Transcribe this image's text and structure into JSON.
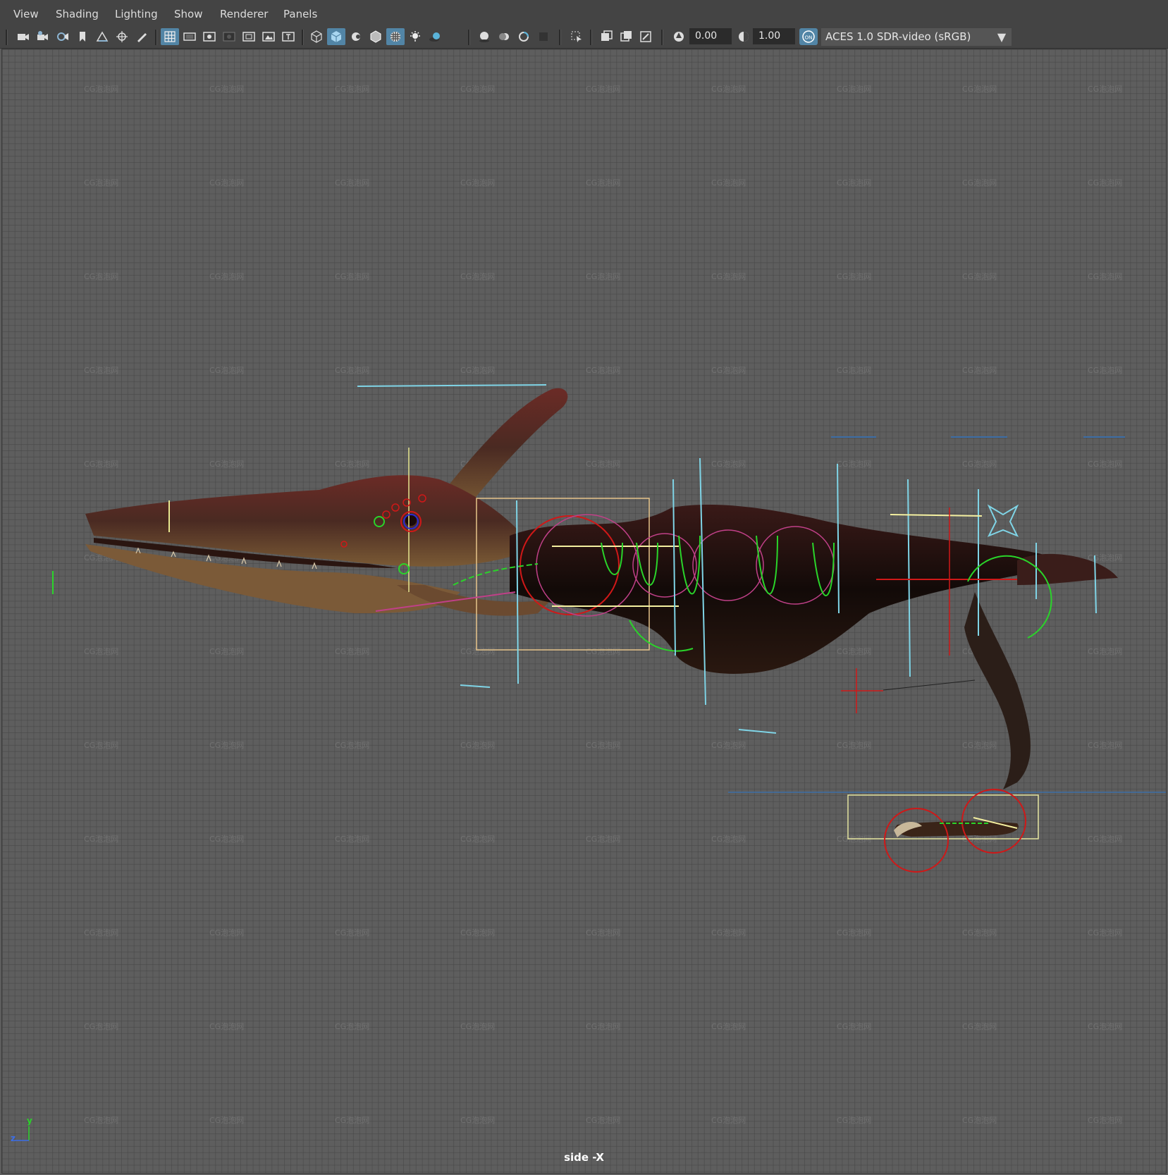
{
  "menu": [
    "View",
    "Shading",
    "Lighting",
    "Show",
    "Renderer",
    "Panels"
  ],
  "toolbar": {
    "exposure": "0.00",
    "gamma": "1.00",
    "color_mgmt_badge": "ON",
    "color_space": "ACES 1.0 SDR-video (sRGB)"
  },
  "viewport": {
    "camera_label": "side -X",
    "watermark": "CG泡泡网",
    "axis_y": "y",
    "axis_z": "z"
  },
  "colors": {
    "active_icon": "#5285a6",
    "grid_bg": "#5e5e5e",
    "ui_bg": "#444444"
  }
}
